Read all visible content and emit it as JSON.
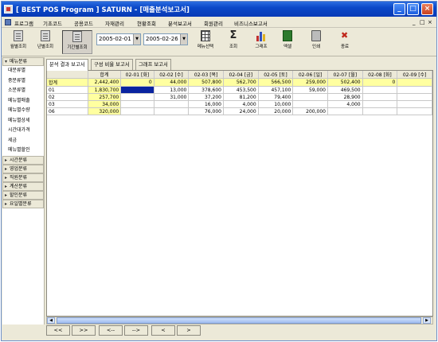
{
  "window": {
    "title": "[ BEST POS Program ]  SATURN   - [매출분석보고서]",
    "controls": [
      "_",
      "□",
      "×"
    ]
  },
  "menu": {
    "items": [
      "프로그램",
      "기초코드",
      "공용코드",
      "자재관리",
      "현황조회",
      "분석보고서",
      "회원관리",
      "비즈니스보고서"
    ],
    "right_icons": [
      "_",
      "□",
      "×"
    ]
  },
  "toolbar": {
    "buttons": [
      {
        "label": "월별조회",
        "icon": "document-icon"
      },
      {
        "label": "년별조회",
        "icon": "document-icon"
      },
      {
        "label": "기간별조회",
        "icon": "document-icon",
        "pressed": true
      }
    ],
    "date_from": "2005-02-01",
    "date_to": "2005-02-26",
    "actions": [
      {
        "label": "메뉴선택",
        "icon": "grid-icon"
      },
      {
        "label": "조회",
        "icon": "sum-icon"
      },
      {
        "label": "그래프",
        "icon": "chart-icon"
      },
      {
        "label": "엑셀",
        "icon": "excel-icon"
      },
      {
        "label": "인쇄",
        "icon": "print-icon"
      },
      {
        "label": "종료",
        "icon": "exit-icon"
      }
    ]
  },
  "sidebar": {
    "groups": [
      {
        "label": "메뉴분류",
        "expanded": true,
        "items": [
          "대분류별",
          "중분류별",
          "소분류별",
          "메뉴별매출",
          "메뉴별수량",
          "메뉴별상세",
          "시간대가격",
          "세금",
          "메뉴별할인"
        ]
      },
      {
        "label": "시간분류",
        "expanded": false,
        "items": []
      },
      {
        "label": "영업분류",
        "expanded": false,
        "items": []
      },
      {
        "label": "직원분류",
        "expanded": false,
        "items": []
      },
      {
        "label": "계산분류",
        "expanded": false,
        "items": []
      },
      {
        "label": "할인분류",
        "expanded": false,
        "items": []
      },
      {
        "label": "요일별분류",
        "expanded": false,
        "items": []
      }
    ]
  },
  "tabs": [
    "분석 결과 보고서",
    "구성 비율 보고서",
    "그래프 보고서"
  ],
  "grid": {
    "columns": [
      "",
      "합계",
      "02-01 [화]",
      "02-02 [수]",
      "02-03 [목]",
      "02-04 [금]",
      "02-05 [토]",
      "02-06 [일]",
      "02-07 [월]",
      "02-08 [화]",
      "02-09 [수]"
    ],
    "rows": [
      {
        "label": "합계",
        "cells": [
          "2,442,400",
          "0",
          "44,000",
          "507,800",
          "562,700",
          "566,500",
          "259,000",
          "502,400",
          "0",
          ""
        ]
      },
      {
        "label": "01",
        "cells": [
          "1,830,700",
          "",
          "13,000",
          "378,600",
          "453,500",
          "457,100",
          "59,000",
          "469,500",
          "",
          ""
        ]
      },
      {
        "label": "02",
        "cells": [
          "257,700",
          "",
          "31,000",
          "37,200",
          "81,200",
          "79,400",
          "",
          "28,900",
          "",
          ""
        ]
      },
      {
        "label": "03",
        "cells": [
          "34,000",
          "",
          "",
          "16,000",
          "4,000",
          "10,000",
          "",
          "4,000",
          "",
          ""
        ]
      },
      {
        "label": "06",
        "cells": [
          "320,000",
          "",
          "",
          "76,000",
          "24,000",
          "20,000",
          "200,000",
          "",
          "",
          ""
        ]
      }
    ]
  },
  "navigation": {
    "buttons": [
      "<<",
      ">>",
      "<--",
      "-->",
      "<",
      ">"
    ]
  }
}
